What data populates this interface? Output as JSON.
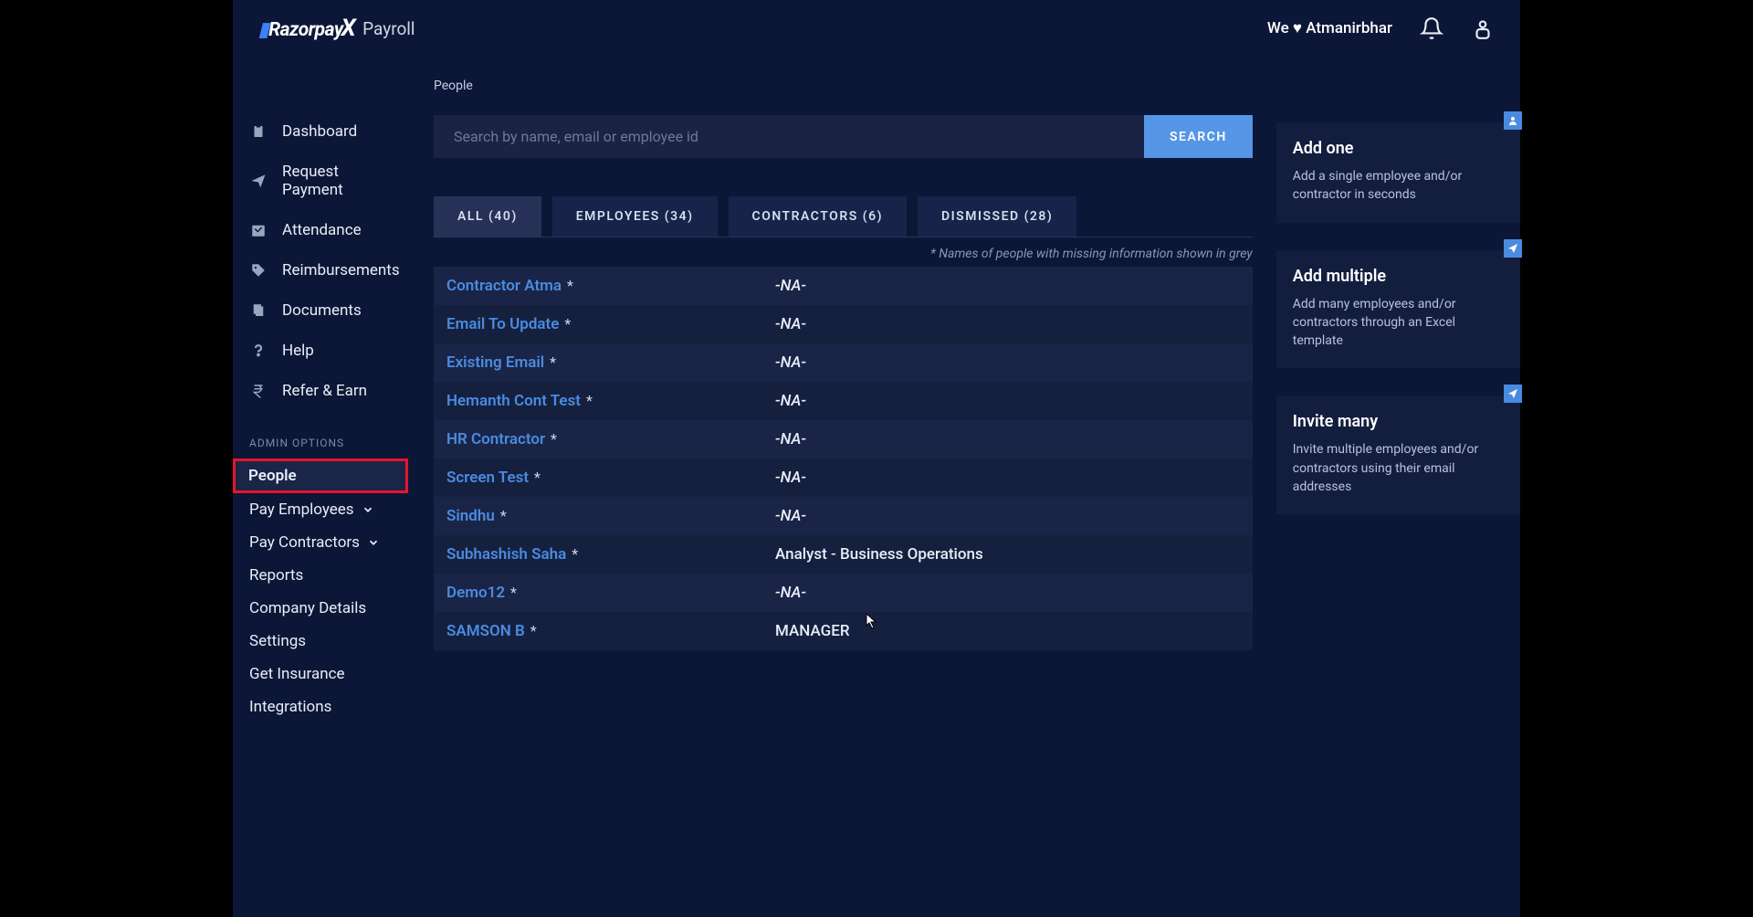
{
  "header": {
    "brandPrefix": "Razorpay",
    "brandX": "X",
    "brandSub": "Payroll",
    "tagline": "We ♥ Atmanirbhar"
  },
  "sidebar": {
    "nav": [
      {
        "label": "Dashboard",
        "icon": "clipboard"
      },
      {
        "label": "Request Payment",
        "icon": "send"
      },
      {
        "label": "Attendance",
        "icon": "calendar"
      },
      {
        "label": "Reimbursements",
        "icon": "tag"
      },
      {
        "label": "Documents",
        "icon": "docs"
      },
      {
        "label": "Help",
        "icon": "help"
      },
      {
        "label": "Refer & Earn",
        "icon": "rupee"
      }
    ],
    "adminLabel": "ADMIN OPTIONS",
    "admin": [
      {
        "label": "People",
        "active": true,
        "chev": false
      },
      {
        "label": "Pay Employees",
        "active": false,
        "chev": true
      },
      {
        "label": "Pay Contractors",
        "active": false,
        "chev": true
      },
      {
        "label": "Reports",
        "active": false,
        "chev": false
      },
      {
        "label": "Company Details",
        "active": false,
        "chev": false
      },
      {
        "label": "Settings",
        "active": false,
        "chev": false
      },
      {
        "label": "Get Insurance",
        "active": false,
        "chev": false
      },
      {
        "label": "Integrations",
        "active": false,
        "chev": false
      }
    ]
  },
  "page": {
    "title": "People",
    "searchPlaceholder": "Search by name, email or employee id",
    "searchBtn": "SEARCH",
    "tabs": [
      {
        "label": "ALL (40)",
        "active": true
      },
      {
        "label": "EMPLOYEES (34)",
        "active": false
      },
      {
        "label": "CONTRACTORS (6)",
        "active": false
      },
      {
        "label": "DISMISSED (28)",
        "active": false
      }
    ],
    "note": "* Names of people with missing information shown in grey",
    "rows": [
      {
        "name": "Contractor Atma",
        "star": true,
        "role": "-NA-",
        "na": true
      },
      {
        "name": "Email To Update",
        "star": true,
        "role": "-NA-",
        "na": true
      },
      {
        "name": "Existing Email",
        "star": true,
        "role": "-NA-",
        "na": true
      },
      {
        "name": "Hemanth Cont Test",
        "star": true,
        "role": "-NA-",
        "na": true
      },
      {
        "name": "HR Contractor",
        "star": true,
        "role": "-NA-",
        "na": true
      },
      {
        "name": "Screen Test",
        "star": true,
        "role": "-NA-",
        "na": true
      },
      {
        "name": "Sindhu",
        "star": true,
        "role": "-NA-",
        "na": true
      },
      {
        "name": "Subhashish Saha",
        "star": true,
        "role": "Analyst - Business Operations",
        "na": false
      },
      {
        "name": "Demo12",
        "star": true,
        "role": "-NA-",
        "na": true
      },
      {
        "name": "SAMSON B",
        "star": true,
        "role": "MANAGER",
        "na": false
      }
    ]
  },
  "cards": [
    {
      "title": "Add one",
      "desc": "Add a single employee and/or contractor in seconds",
      "icon": "person"
    },
    {
      "title": "Add multiple",
      "desc": "Add many employees and/or contractors through an Excel template",
      "icon": "send"
    },
    {
      "title": "Invite many",
      "desc": "Invite multiple employees and/or contractors using their email addresses",
      "icon": "send"
    }
  ]
}
